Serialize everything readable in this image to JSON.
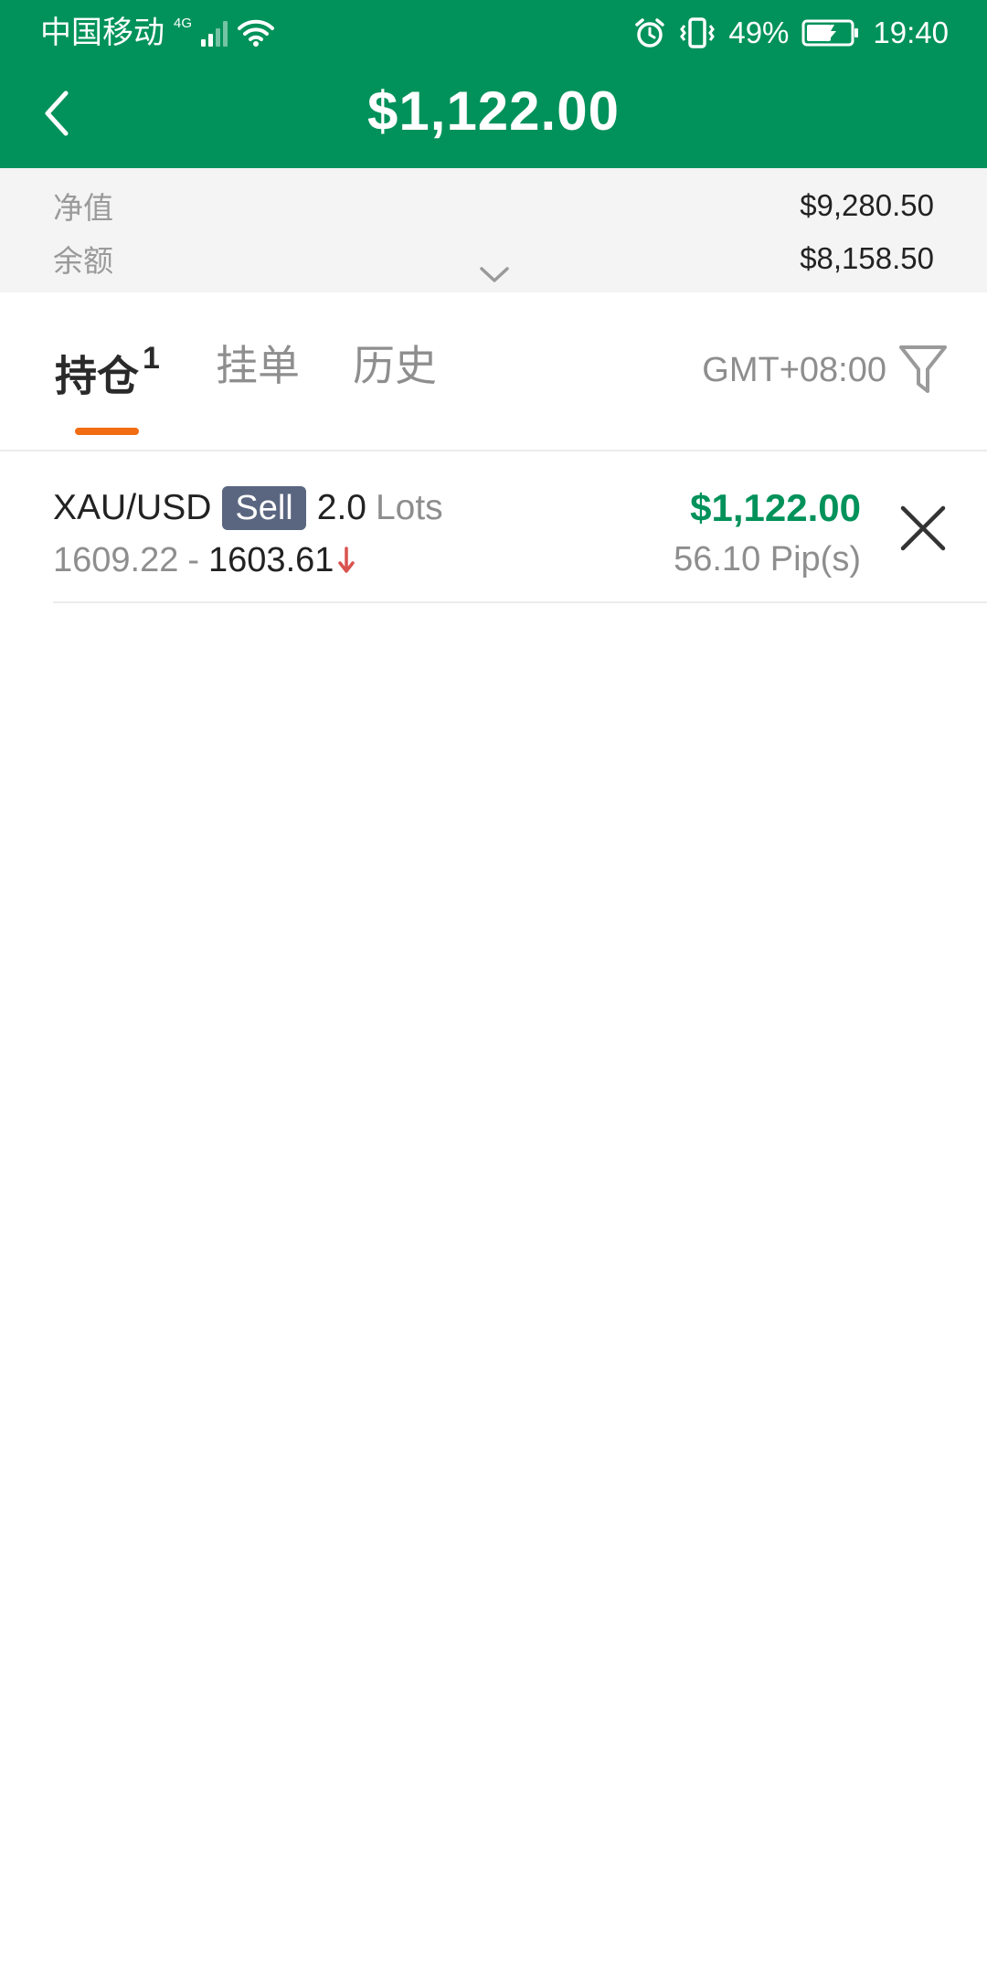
{
  "status_bar": {
    "carrier": "中国移动",
    "network_type": "4G",
    "battery_percent": "49%",
    "time": "19:40"
  },
  "header": {
    "title": "$1,122.00"
  },
  "summary": {
    "equity_label": "净值",
    "equity_value": "$9,280.50",
    "balance_label": "余额",
    "balance_value": "$8,158.50"
  },
  "tabs": {
    "positions_label": "持仓",
    "positions_count": "1",
    "pending_label": "挂单",
    "history_label": "历史",
    "timezone": "GMT+08:00"
  },
  "positions": [
    {
      "symbol": "XAU/USD",
      "side": "Sell",
      "lots": "2.0",
      "lots_unit": "Lots",
      "open_price": "1609.22",
      "separator": "-",
      "current_price": "1603.61",
      "profit": "$1,122.00",
      "pips": "56.10 Pip(s)"
    }
  ],
  "colors": {
    "brand_green": "#00925A",
    "tab_indicator": "#F26C12",
    "sell_badge": "#5A6680",
    "down_arrow": "#D9534F"
  },
  "icons": {
    "back": "back-arrow-icon",
    "filter": "filter-icon",
    "close": "close-icon",
    "expand": "chevron-down-icon",
    "price_direction": "arrow-down-icon"
  }
}
